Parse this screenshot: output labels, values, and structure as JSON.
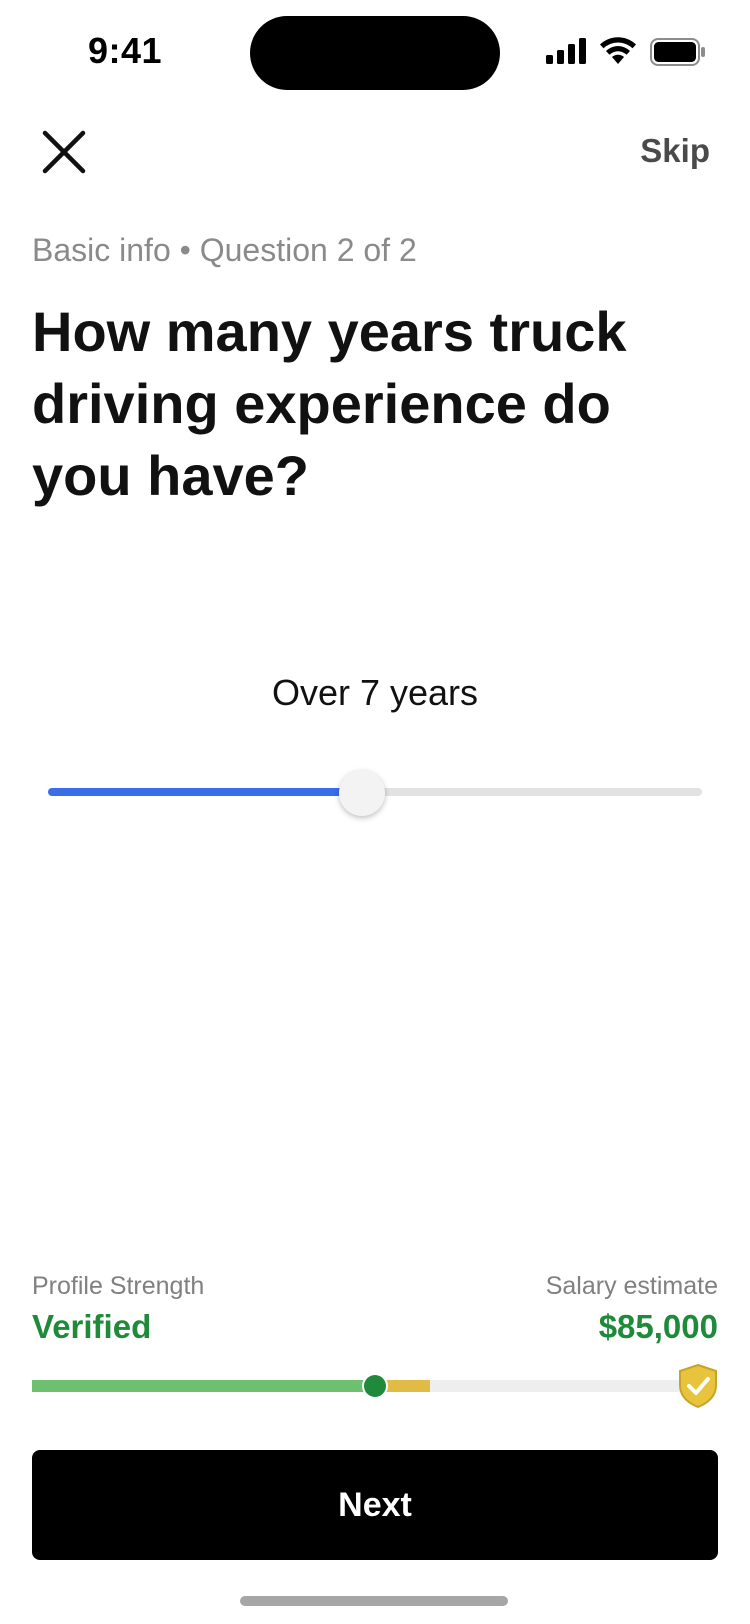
{
  "status_bar": {
    "time": "9:41"
  },
  "nav": {
    "close_icon": "close-icon",
    "skip_label": "Skip"
  },
  "subtitle": "Basic info • Question 2 of 2",
  "question": "How many years truck driving experience do you have?",
  "slider": {
    "value_label": "Over 7 years",
    "value_fraction": 0.48,
    "fill_color": "#3a6ee8"
  },
  "profile": {
    "strength_label": "Profile Strength",
    "strength_value": "Verified",
    "salary_label": "Salary estimate",
    "salary_value": "$85,000",
    "progress_green_fraction": 0.5,
    "progress_yellow_fraction": 0.08,
    "colors": {
      "green": "#1f8a3a",
      "light_green": "#6cc070",
      "yellow": "#e0bb45"
    },
    "badge_icon": "shield-check-icon"
  },
  "next_label": "Next"
}
